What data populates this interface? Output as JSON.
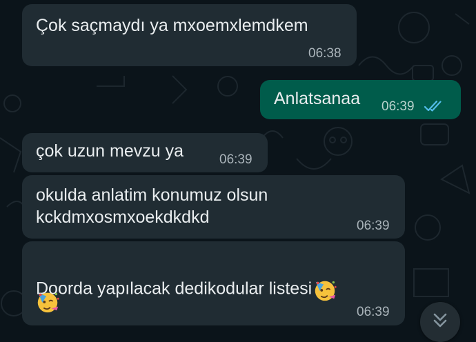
{
  "messages": [
    {
      "id": "m1",
      "direction": "incoming",
      "text": "Çok saçmaydı ya mxoemxlemdkem",
      "time": "06:38"
    },
    {
      "id": "m2",
      "direction": "outgoing",
      "text": "Anlatsanaa",
      "time": "06:39",
      "status": "read"
    },
    {
      "id": "m3",
      "direction": "incoming",
      "text": "çok uzun mevzu ya",
      "time": "06:39"
    },
    {
      "id": "m4",
      "direction": "incoming",
      "text_line1": "okulda anlatim konumuz olsun",
      "text_line2": "kckdmxosmxoekdkdkd",
      "time": "06:39"
    },
    {
      "id": "m5",
      "direction": "incoming",
      "text": "Doorda yapılacak dedikodular listesi",
      "emoji": "partying-face",
      "time": "06:39"
    }
  ],
  "icons": {
    "read_receipt": "double-check-icon",
    "scroll_down": "chevron-double-down-icon",
    "emoji": "partying-face-emoji"
  },
  "colors": {
    "background": "#0b141a",
    "incoming_bubble": "#202c33",
    "outgoing_bubble": "#005c4b",
    "read_tick": "#53bdeb"
  }
}
